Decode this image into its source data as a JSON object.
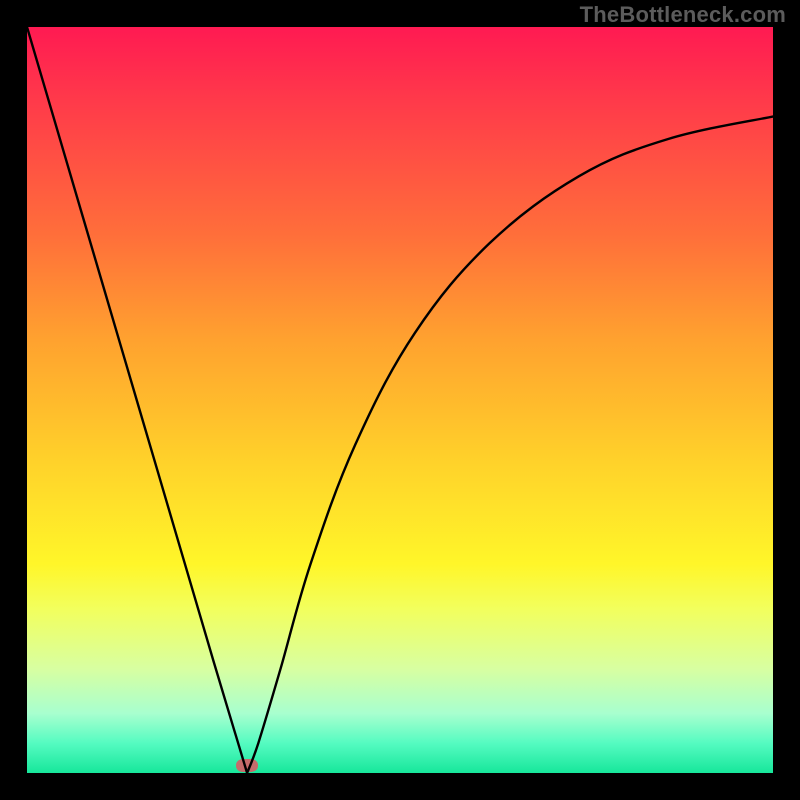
{
  "watermark": "TheBottleneck.com",
  "chart_data": {
    "type": "line",
    "title": "",
    "xlabel": "",
    "ylabel": "",
    "xlim": [
      0,
      1
    ],
    "ylim": [
      0,
      1
    ],
    "background_gradient": {
      "top_color": "#ff1a52",
      "mid_color": "#fff629",
      "bottom_color": "#17e79b",
      "meaning_top": "high bottleneck",
      "meaning_bottom": "no bottleneck"
    },
    "optimum": {
      "x": 0.295,
      "y": 0.0
    },
    "marker": {
      "color": "#c56b6b",
      "shape": "rounded-rect"
    },
    "series": [
      {
        "name": "bottleneck-curve",
        "x": [
          0.0,
          0.05,
          0.1,
          0.15,
          0.2,
          0.25,
          0.28,
          0.295,
          0.31,
          0.34,
          0.38,
          0.44,
          0.52,
          0.62,
          0.74,
          0.86,
          1.0
        ],
        "y": [
          1.0,
          0.83,
          0.66,
          0.49,
          0.32,
          0.15,
          0.05,
          0.0,
          0.04,
          0.14,
          0.28,
          0.44,
          0.59,
          0.71,
          0.8,
          0.85,
          0.88
        ]
      }
    ]
  }
}
